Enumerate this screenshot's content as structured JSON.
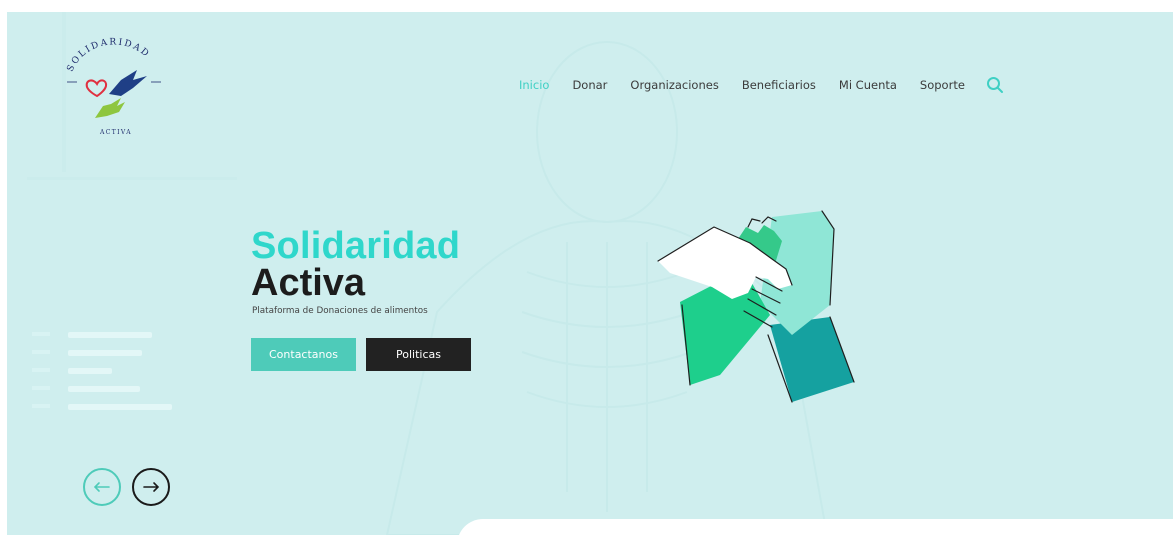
{
  "logo": {
    "arc_text": "SOLIDARIDAD",
    "bottom_text": "ACTIVA"
  },
  "nav": {
    "items": [
      {
        "label": "Inicio",
        "active": true
      },
      {
        "label": "Donar",
        "active": false
      },
      {
        "label": "Organizaciones",
        "active": false
      },
      {
        "label": "Beneficiarios",
        "active": false
      },
      {
        "label": "Mi Cuenta",
        "active": false
      },
      {
        "label": "Soporte",
        "active": false
      }
    ],
    "search_icon": "search-icon"
  },
  "hero": {
    "title_line1": "Solidaridad",
    "title_line2": "Activa",
    "subtitle": "Plataforma de Donaciones de alimentos",
    "primary_button": "Contactanos",
    "secondary_button": "Politicas",
    "illustration": "stacked-hands"
  },
  "slider": {
    "prev_icon": "arrow-left-icon",
    "next_icon": "arrow-right-icon"
  },
  "colors": {
    "hero_background": "#cfeeee",
    "accent_teal": "#2fd7cb",
    "nav_active": "#3fd0c4",
    "button_primary": "#4ecbb9",
    "button_secondary": "#222222",
    "text_dark": "#1c1c1c"
  }
}
